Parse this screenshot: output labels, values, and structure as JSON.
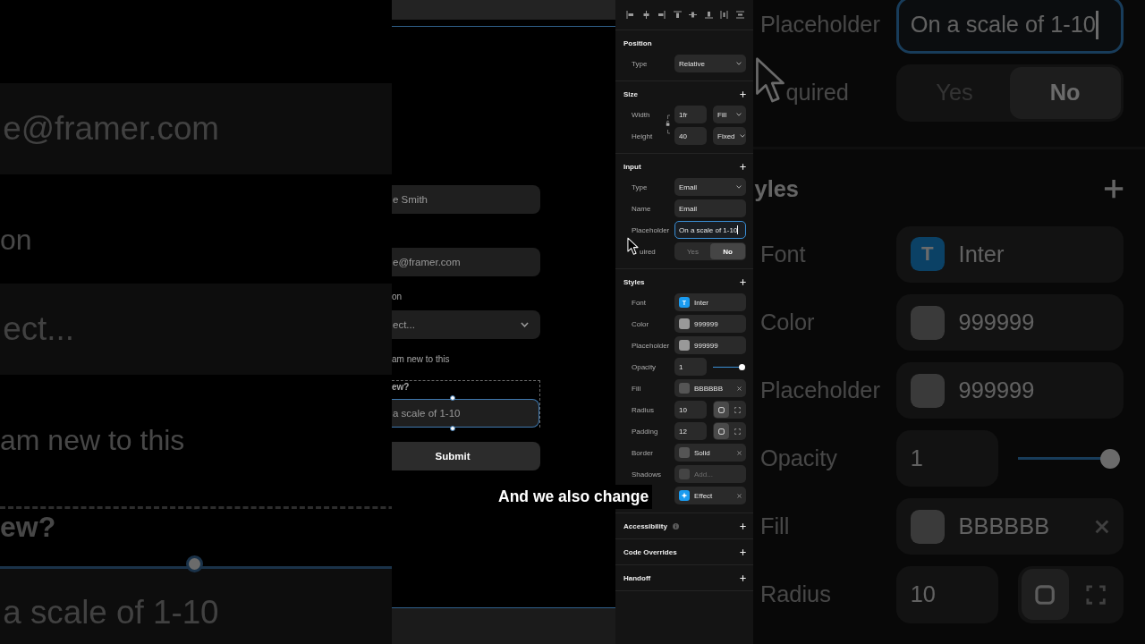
{
  "left_backdrop": {
    "form": [
      {
        "kind": "input",
        "placeholder": "e@framer.com",
        "selected": false
      },
      {
        "kind": "label",
        "text": "on"
      },
      {
        "kind": "select",
        "placeholder": "ect..."
      },
      {
        "kind": "checkbox_label",
        "text": "am new to this"
      },
      {
        "kind": "question",
        "label": "ew?",
        "input": {
          "placeholder": "a scale of 1-10",
          "selected": true
        }
      }
    ]
  },
  "canvas": {
    "form": [
      {
        "kind": "input",
        "placeholder": "e Smith",
        "selected": false
      },
      {
        "kind": "input",
        "placeholder": "e@framer.com",
        "selected": false
      },
      {
        "kind": "label",
        "text": "on"
      },
      {
        "kind": "select",
        "placeholder": "ect..."
      },
      {
        "kind": "checkbox_label",
        "text": "am new to this"
      },
      {
        "kind": "question",
        "label": "ew?",
        "input": {
          "placeholder": "a scale of 1-10",
          "selected": true
        }
      },
      {
        "kind": "button",
        "text": "Submit"
      }
    ]
  },
  "panel": {
    "sections": [
      {
        "title": "Position",
        "add": false,
        "rows": [
          {
            "kind": "select",
            "label": "Type",
            "value": "Relative"
          }
        ]
      },
      {
        "title": "Size",
        "add": true,
        "rows": [
          {
            "kind": "size",
            "label": "Width",
            "value": "1fr",
            "mode": "Fill"
          },
          {
            "kind": "size",
            "label": "Height",
            "value": "40",
            "mode": "Fixed"
          }
        ]
      },
      {
        "title": "Input",
        "add": true,
        "rows": [
          {
            "kind": "select",
            "label": "Type",
            "value": "Email"
          },
          {
            "kind": "text",
            "label": "Name",
            "value": "Email",
            "focused": false
          },
          {
            "kind": "text",
            "label": "Placeholder",
            "value": "On a scale of 1-10",
            "focused": true
          },
          {
            "kind": "segmented",
            "label": "uired",
            "options": [
              {
                "label": "Yes",
                "selected": false
              },
              {
                "label": "No",
                "selected": true
              }
            ]
          }
        ]
      },
      {
        "title": "Styles",
        "add": true,
        "rows": [
          {
            "kind": "font",
            "label": "Font",
            "badge": "T",
            "value": "Inter"
          },
          {
            "kind": "swatch",
            "label": "Color",
            "value": "999999",
            "color": "#999999",
            "removable": false
          },
          {
            "kind": "swatch",
            "label": "Placeholder",
            "value": "999999",
            "color": "#999999",
            "removable": false
          },
          {
            "kind": "opacity",
            "label": "Opacity",
            "value": "1",
            "level": 1
          },
          {
            "kind": "swatch",
            "label": "Fill",
            "value": "BBBBBB",
            "color": "#555555",
            "removable": true
          },
          {
            "kind": "corner",
            "label": "Radius",
            "value": "10",
            "modes": [
              {
                "selected": true
              },
              {
                "selected": false
              }
            ]
          },
          {
            "kind": "corner",
            "label": "Padding",
            "value": "12",
            "modes": [
              {
                "selected": true
              },
              {
                "selected": false
              }
            ]
          },
          {
            "kind": "swatch",
            "label": "Border",
            "value": "Solid",
            "color": "#555555",
            "removable": true
          },
          {
            "kind": "swatch",
            "label": "Shadows",
            "placeholder": "Add...",
            "color": "#444444",
            "removable": false
          },
          {
            "kind": "effect",
            "value": "Effect",
            "removable": true
          }
        ]
      },
      {
        "title": "Accessibility",
        "add": true,
        "info": true
      },
      {
        "title": "Code Overrides",
        "add": true
      },
      {
        "title": "Handoff",
        "add": true
      }
    ]
  },
  "right_backdrop": {
    "rows": [
      {
        "kind": "text",
        "label": "Placeholder",
        "value": "On a scale of 1-10",
        "focused": true
      },
      {
        "kind": "segmented",
        "label": "quired",
        "options": [
          {
            "label": "Yes",
            "selected": false
          },
          {
            "label": "No",
            "selected": true
          }
        ]
      }
    ],
    "section": {
      "title": "yles",
      "add": true,
      "rows": [
        {
          "kind": "font",
          "label": "Font",
          "badge": "T",
          "value": "Inter"
        },
        {
          "kind": "swatch",
          "label": "Color",
          "value": "999999",
          "removable": false
        },
        {
          "kind": "swatch",
          "label": "Placeholder",
          "value": "999999",
          "removable": false
        },
        {
          "kind": "opacity",
          "label": "Opacity",
          "value": "1",
          "level": 1
        },
        {
          "kind": "swatch",
          "label": "Fill",
          "value": "BBBBBB",
          "removable": true
        },
        {
          "kind": "corner",
          "label": "Radius",
          "value": "10",
          "modes": [
            {
              "selected": true
            },
            {
              "selected": false
            }
          ]
        }
      ]
    }
  },
  "subtitle": "And we also change"
}
